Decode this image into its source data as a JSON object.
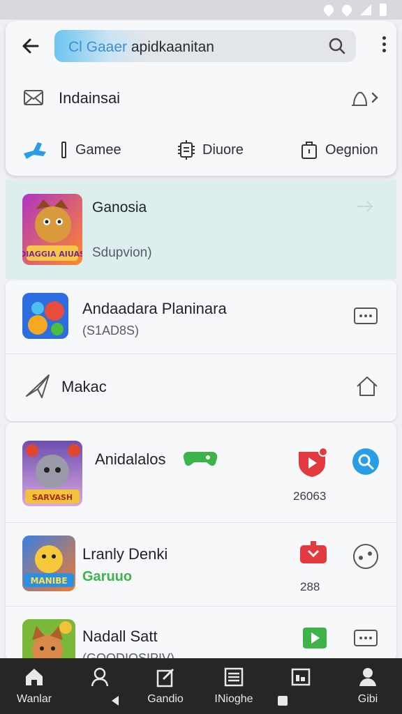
{
  "header": {
    "search_value_faded": "Cl Gaaer",
    "search_value": " apidkaanitan",
    "account_label": "Indainsai"
  },
  "tabs": [
    {
      "label": "Gamee",
      "icon": "game-controller-icon"
    },
    {
      "label": "Diuore",
      "icon": "chip-icon"
    },
    {
      "label": "Oegnion",
      "icon": "bag-icon"
    }
  ],
  "featured": {
    "title": "Ganosia",
    "subtitle": "Sdupvion)",
    "thumb_text": "DIAGGIA AIUAS"
  },
  "list1": [
    {
      "title": "Andaadara Planinara",
      "subtitle": "(S1AD8S)"
    },
    {
      "title": "Makac"
    }
  ],
  "list2": [
    {
      "title": "Anidalalos",
      "count": "26063",
      "thumb_text": "SARVASH"
    },
    {
      "title": "Lranly Denki",
      "badge": "Garuuo",
      "count": "288",
      "thumb_text": "MANIBE"
    },
    {
      "title": "Nadall Satt",
      "subtitle": "(GOODIOSIPIV)"
    }
  ],
  "bottom_nav": [
    {
      "label": "Wanlar",
      "icon": "home-icon"
    },
    {
      "label": "",
      "icon": "user-icon"
    },
    {
      "label": "Gandio",
      "icon": "edit-icon"
    },
    {
      "label": "INioghe",
      "icon": "list-icon"
    },
    {
      "label": "",
      "icon": "gallery-icon"
    },
    {
      "label": "Gibi",
      "icon": "profile-icon"
    }
  ],
  "colors": {
    "accent": "#6cc4ef",
    "featured_bg": "#ddeeee",
    "nav_bg": "#262626",
    "green": "#3db34a",
    "red": "#e23a3f",
    "blue": "#2a9de8"
  }
}
